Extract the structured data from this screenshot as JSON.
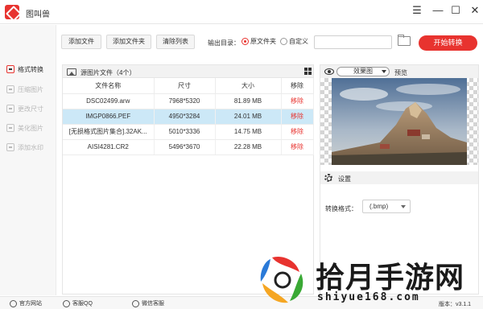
{
  "app": {
    "title": "图叫兽"
  },
  "window": {
    "menu_glyph": "☰",
    "min_glyph": "—",
    "max_glyph": "☐",
    "close_glyph": "✕"
  },
  "sidebar": {
    "items": [
      {
        "label": "格式转换",
        "active": true
      },
      {
        "label": "压缩图片",
        "active": false
      },
      {
        "label": "更改尺寸",
        "active": false
      },
      {
        "label": "美化图片",
        "active": false
      },
      {
        "label": "添加水印",
        "active": false
      }
    ]
  },
  "toolbar": {
    "add_file": "添加文件",
    "add_folder": "添加文件夹",
    "clear_list": "清除列表",
    "output_label": "输出目录：",
    "option_original": "原文件夹",
    "option_custom": "自定义",
    "output_path": "",
    "convert": "开始转换"
  },
  "file_panel": {
    "title": "源图片文件（4个）",
    "columns": [
      "文件名称",
      "尺寸",
      "大小",
      "移除"
    ],
    "rows": [
      {
        "name": "DSC02499.arw",
        "dimensions": "7968*5320",
        "size": "81.89 MB",
        "remove": "移除",
        "selected": false
      },
      {
        "name": "IMGP0866.PEF",
        "dimensions": "4950*3284",
        "size": "24.01 MB",
        "remove": "移除",
        "selected": true
      },
      {
        "name": "[无损格式图片集合].32AK...",
        "dimensions": "5010*3336",
        "size": "14.75 MB",
        "remove": "移除",
        "selected": false
      },
      {
        "name": "AISI4281.CR2",
        "dimensions": "5496*3670",
        "size": "22.28 MB",
        "remove": "移除",
        "selected": false
      }
    ]
  },
  "preview_panel": {
    "effect_select": "效果图",
    "preview_label": "预览",
    "settings_label": "设置",
    "format_label": "转换格式：",
    "format_value": "(.bmp)"
  },
  "footer": {
    "website": "官方网站",
    "qq": "客服QQ",
    "wechat": "微信客服",
    "version": "版本：v3.1.1"
  },
  "watermark": {
    "text": "拾月手游网",
    "url": "shiyue168.com"
  },
  "colors": {
    "accent": "#e8332f",
    "selected_row": "#cce8f7"
  }
}
